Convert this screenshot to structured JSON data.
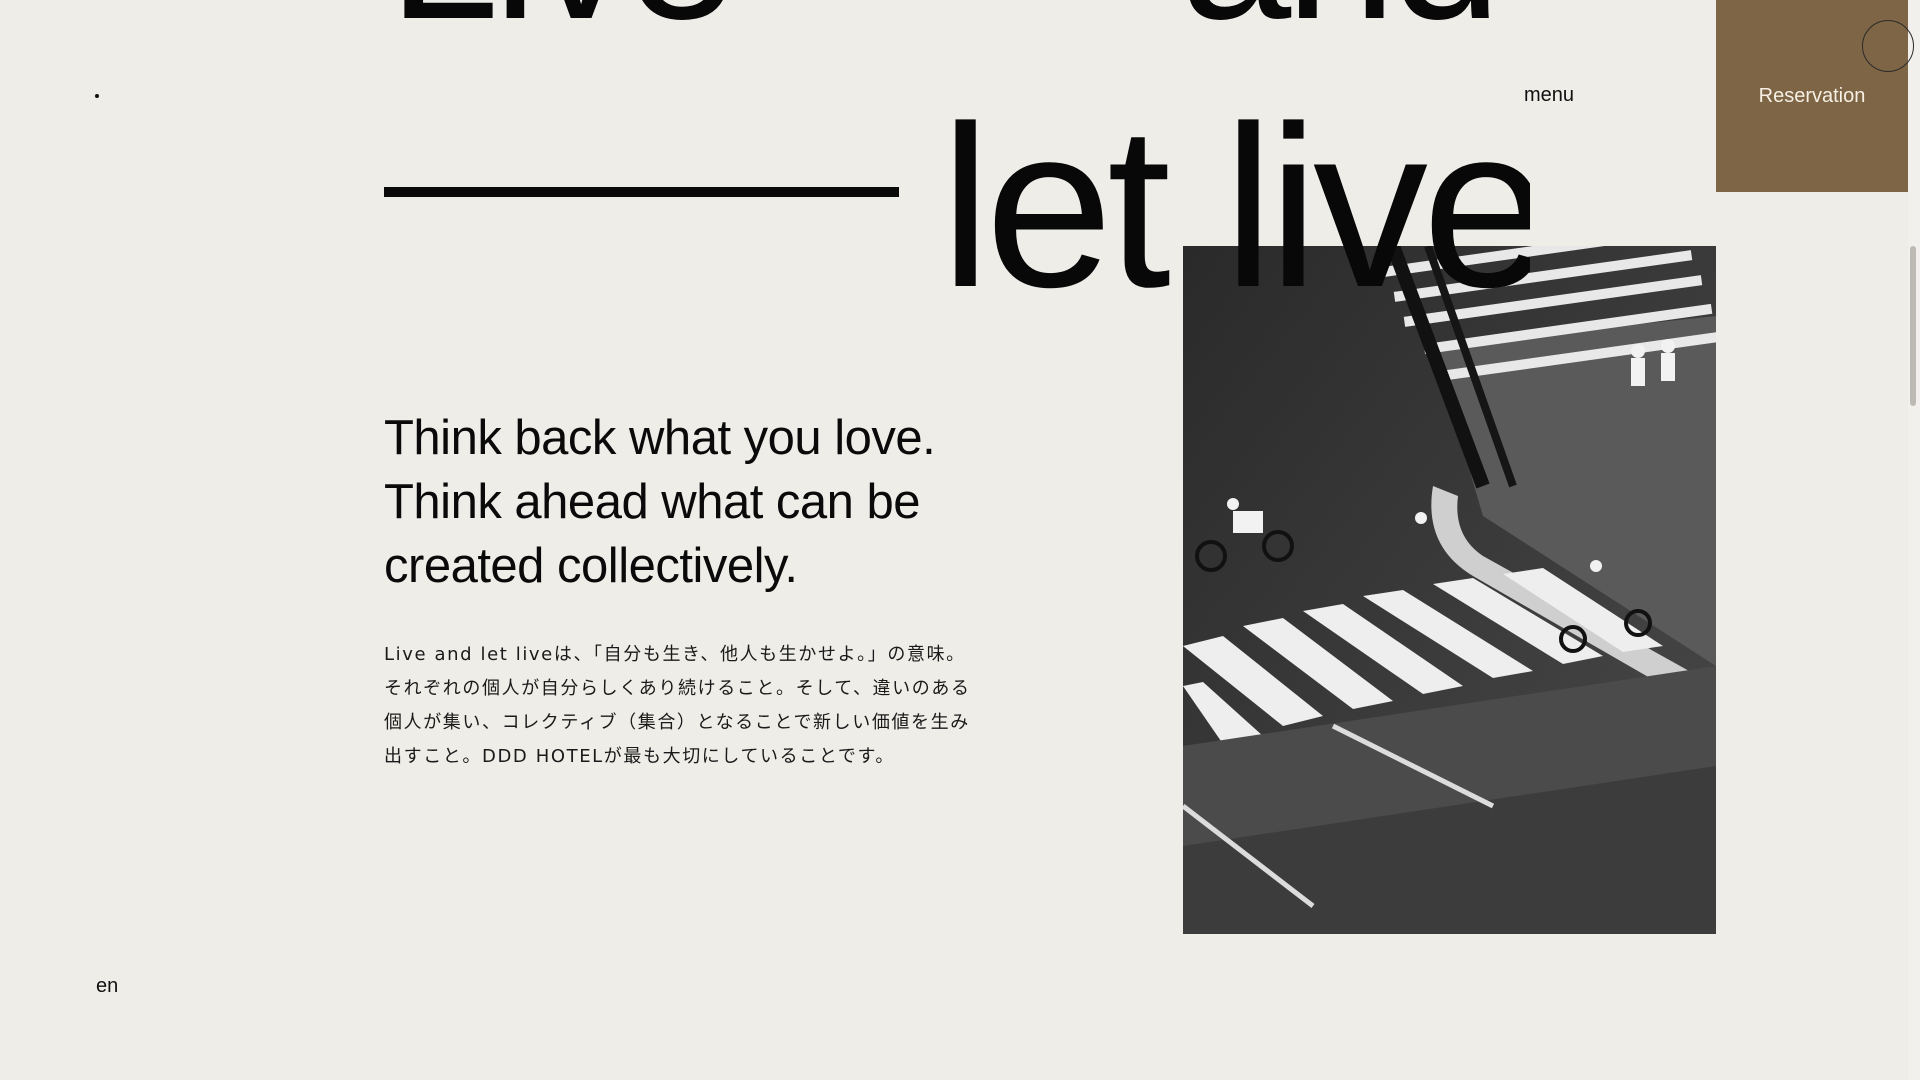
{
  "hero": {
    "word_live": "Live",
    "word_and": "and",
    "word_let_live": "let live"
  },
  "header": {
    "menu_label": "menu",
    "reservation_label": "Reservation"
  },
  "tagline": {
    "line1": "Think back what you love.",
    "line2": "Think ahead what can be",
    "line3": "created collectively."
  },
  "body": {
    "text": "Live and let liveは、「自分も生き、他人も生かせよ。」の意味。それぞれの個人が自分らしくあり続けること。そして、違いのある個人が集い、コレクティブ（集合）となることで新しい価値を生み出すこと。DDD HOTELが最も大切にしていることです。"
  },
  "footer": {
    "language": "en"
  },
  "colors": {
    "background": "#efede8",
    "accent": "#7d6545",
    "text": "#0a0a0a"
  }
}
